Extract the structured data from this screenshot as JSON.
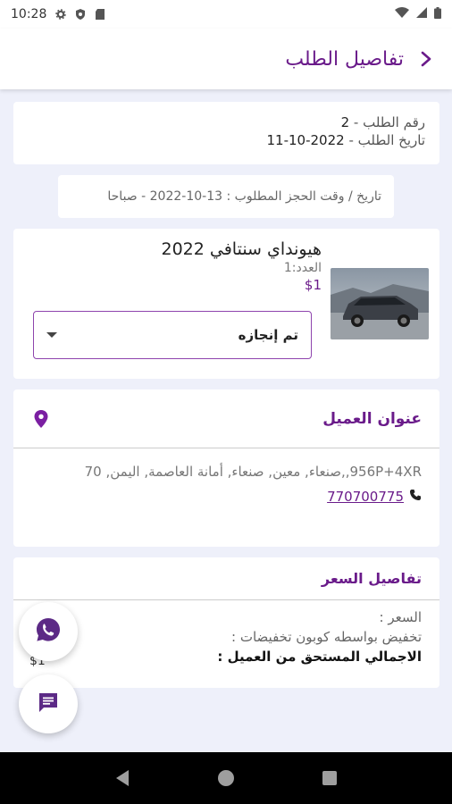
{
  "status_bar": {
    "time": "10:28"
  },
  "app_bar": {
    "title": "تفاصيل الطلب"
  },
  "order": {
    "number_label": "رقم الطلب - ",
    "number_value": "2",
    "date_label": "تاريخ الطلب - ",
    "date_value": "2022-10-11"
  },
  "booking": {
    "text": "تاريخ / وقت الحجز المطلوب : 13-10-2022 - صباحا"
  },
  "product": {
    "name": "هيونداي سنتافي 2022",
    "qty": "العدد:1",
    "price": "$1",
    "status_selected": "تم إنجازه"
  },
  "address": {
    "title": "عنوان العميل",
    "text": "956P+4XR,,صنعاء, معين, صنعاء, أمانة العاصمة, اليمن, 70",
    "phone": "770700775"
  },
  "price_details": {
    "title": "تفاصيل السعر",
    "price_row": "السعر :",
    "discount_row": "تخفيض بواسطه كوبون تخفيضات :",
    "total_row": "الاجمالي المستحق من العميل :",
    "amount": "$1"
  },
  "colors": {
    "accent": "#6a1b8a",
    "whatsapp": "#5c2a86"
  },
  "icons": [
    "settings-icon",
    "shield-icon",
    "sd-card-icon",
    "wifi-icon",
    "signal-icon",
    "battery-icon",
    "back-chevron-icon",
    "location-pin-icon",
    "phone-icon",
    "whatsapp-icon",
    "chat-icon",
    "nav-back-icon",
    "nav-home-icon",
    "nav-recents-icon"
  ]
}
